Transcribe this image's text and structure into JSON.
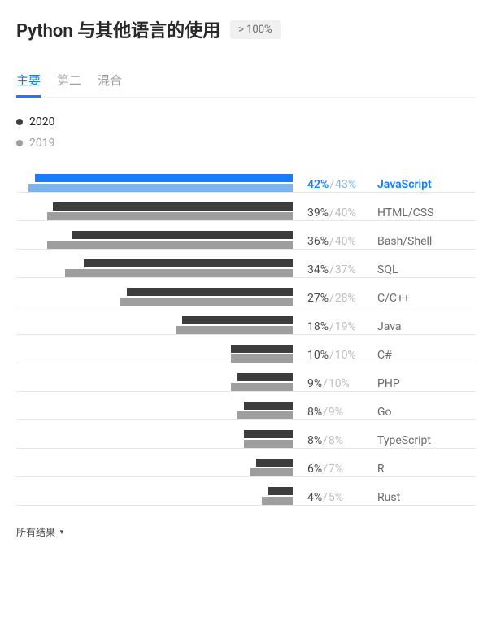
{
  "header": {
    "title": "Python 与其他语言的使用",
    "badge": "> 100%"
  },
  "tabs": {
    "items": [
      {
        "label": "主要",
        "active": true
      },
      {
        "label": "第二",
        "active": false
      },
      {
        "label": "混合",
        "active": false
      }
    ]
  },
  "legend": {
    "y2020": "2020",
    "y2019": "2019"
  },
  "chart_data": {
    "type": "bar",
    "title": "Python 与其他语言的使用",
    "xlabel": "",
    "ylabel": "",
    "xlim": [
      0,
      45
    ],
    "categories": [
      "JavaScript",
      "HTML/CSS",
      "Bash/Shell",
      "SQL",
      "C/C++",
      "Java",
      "C#",
      "PHP",
      "Go",
      "TypeScript",
      "R",
      "Rust"
    ],
    "series": [
      {
        "name": "2020",
        "values": [
          42,
          39,
          36,
          34,
          27,
          18,
          10,
          9,
          8,
          8,
          6,
          4
        ]
      },
      {
        "name": "2019",
        "values": [
          43,
          40,
          40,
          37,
          28,
          19,
          10,
          10,
          9,
          8,
          7,
          5
        ]
      }
    ],
    "highlight_index": 0
  },
  "all_results_label": "所有结果"
}
